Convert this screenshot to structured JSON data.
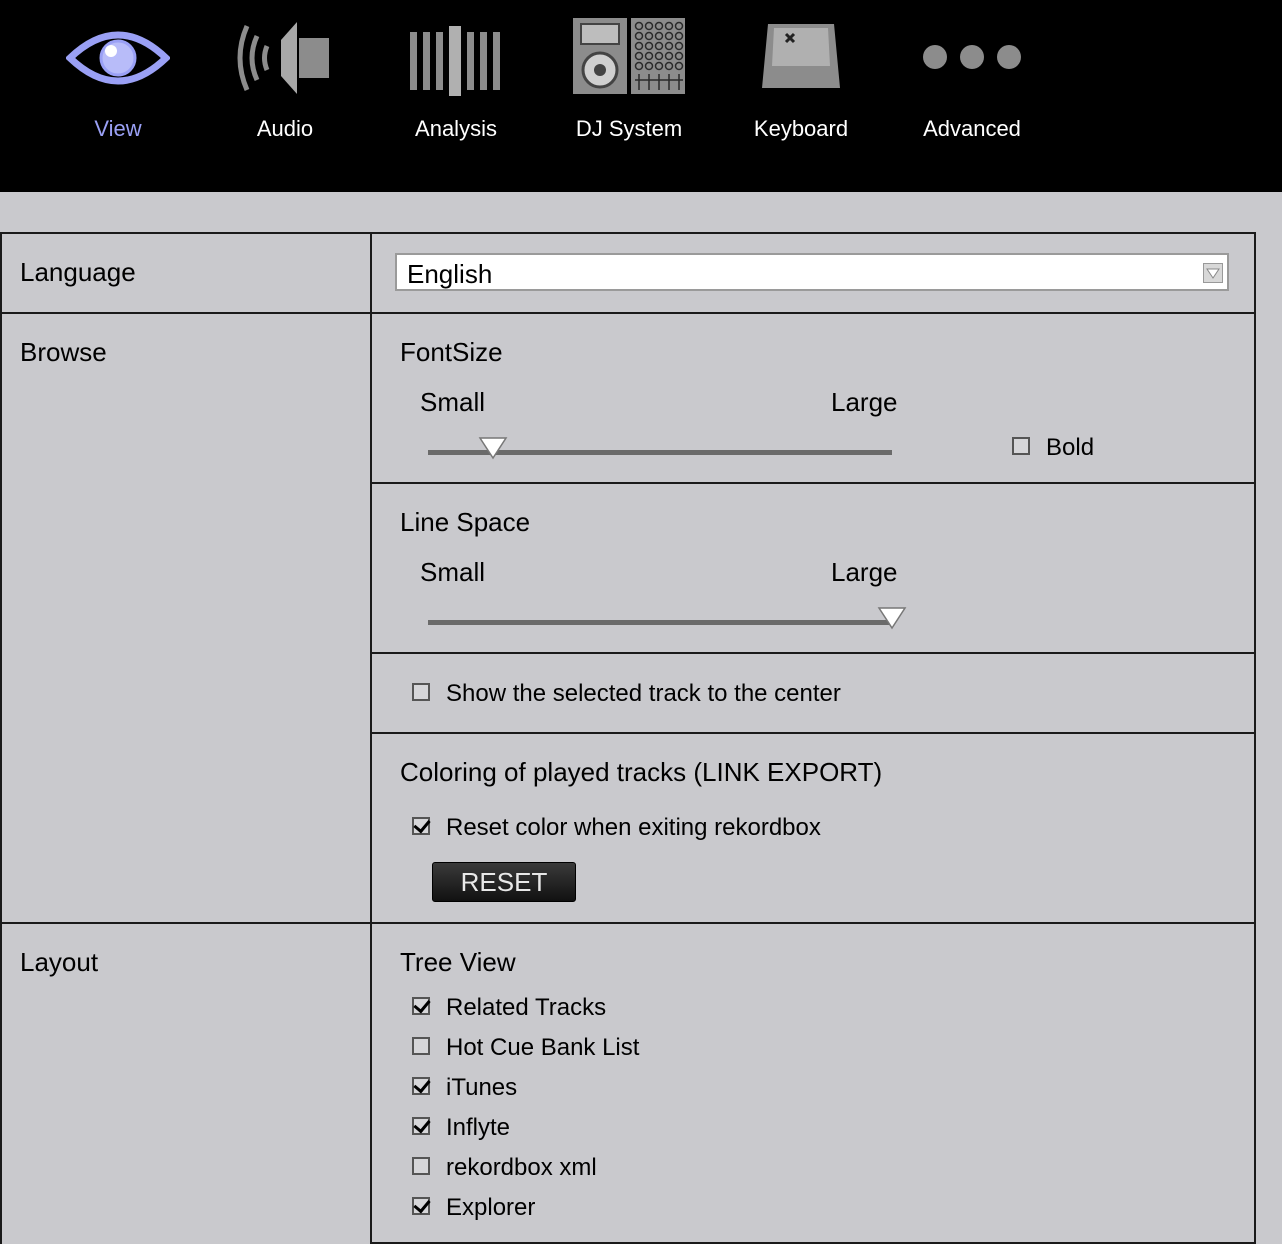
{
  "tabs": [
    {
      "label": "View",
      "icon": "eye-icon",
      "active": true
    },
    {
      "label": "Audio",
      "icon": "speaker-icon",
      "active": false
    },
    {
      "label": "Analysis",
      "icon": "waveform-bars-icon",
      "active": false
    },
    {
      "label": "DJ System",
      "icon": "dj-player-mixer-icon",
      "active": false
    },
    {
      "label": "Keyboard",
      "icon": "keyboard-key-icon",
      "active": false
    },
    {
      "label": "Advanced",
      "icon": "more-dots-icon",
      "active": false
    }
  ],
  "colors": {
    "toolbar_bg": "#000000",
    "active_tab": "#9aa0f5",
    "panel_bg": "#c9c9cd"
  },
  "language": {
    "label": "Language",
    "selected": "English"
  },
  "browse": {
    "label": "Browse",
    "fontsize": {
      "title": "FontSize",
      "min_label": "Small",
      "max_label": "Large",
      "level": 0.14,
      "bold_label": "Bold",
      "bold_checked": false
    },
    "linespace": {
      "title": "Line Space",
      "min_label": "Small",
      "max_label": "Large",
      "level": 1.0
    },
    "center": {
      "label": "Show the selected track to the center",
      "checked": false
    },
    "coloring": {
      "title": "Coloring of played tracks  (LINK EXPORT)",
      "reset_exit_label": "Reset color when exiting rekordbox",
      "reset_exit_checked": true,
      "reset_button": "RESET"
    }
  },
  "layout": {
    "label": "Layout",
    "tree_view_title": "Tree View",
    "items": [
      {
        "label": "Related Tracks",
        "checked": true
      },
      {
        "label": "Hot Cue Bank List",
        "checked": false
      },
      {
        "label": "iTunes",
        "checked": true
      },
      {
        "label": "Inflyte",
        "checked": true
      },
      {
        "label": "rekordbox xml",
        "checked": false
      },
      {
        "label": "Explorer",
        "checked": true
      }
    ]
  }
}
